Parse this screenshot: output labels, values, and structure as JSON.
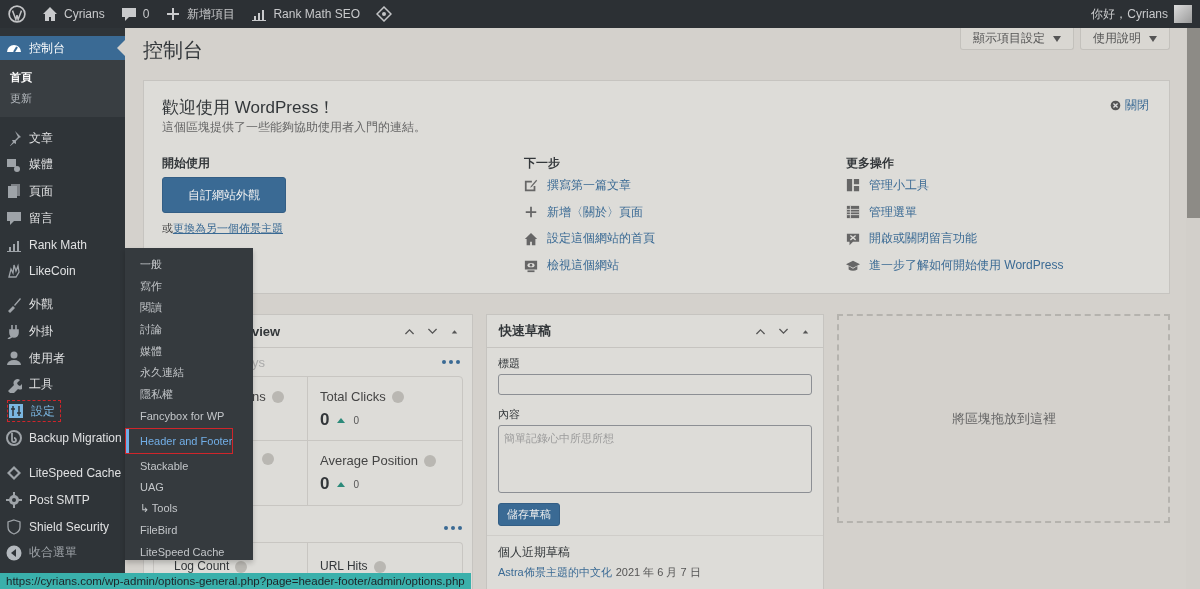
{
  "admin_bar": {
    "site": "Cyrians",
    "comments": "0",
    "new": "新增項目",
    "seo": "Rank Math SEO",
    "greeting": "你好，Cyrians"
  },
  "sidebar": {
    "groups": [
      {
        "items": [
          {
            "label": "控制台",
            "selected": true,
            "hovered": false,
            "outlined": false,
            "children": [
              {
                "label": "首頁",
                "selected": true
              },
              {
                "label": "更新",
                "selected": false
              }
            ]
          }
        ]
      },
      {
        "items": [
          {
            "label": "文章",
            "selected": false,
            "hovered": false,
            "outlined": false
          },
          {
            "label": "媒體",
            "selected": false,
            "hovered": false,
            "outlined": false
          },
          {
            "label": "頁面",
            "selected": false,
            "hovered": false,
            "outlined": false
          },
          {
            "label": "留言",
            "selected": false,
            "hovered": false,
            "outlined": false
          },
          {
            "label": "Rank Math",
            "selected": false,
            "hovered": false,
            "outlined": false
          },
          {
            "label": "LikeCoin",
            "selected": false,
            "hovered": false,
            "outlined": false
          }
        ]
      },
      {
        "items": [
          {
            "label": "外觀",
            "selected": false,
            "hovered": false,
            "outlined": false
          },
          {
            "label": "外掛",
            "selected": false,
            "hovered": false,
            "outlined": false
          },
          {
            "label": "使用者",
            "selected": false,
            "hovered": false,
            "outlined": false
          },
          {
            "label": "工具",
            "selected": false,
            "hovered": false,
            "outlined": false
          },
          {
            "label": "設定",
            "selected": false,
            "hovered": true,
            "outlined": true
          },
          {
            "label": "Backup Migration",
            "selected": false,
            "hovered": false,
            "outlined": false
          }
        ]
      },
      {
        "items": [
          {
            "label": "LiteSpeed Cache",
            "selected": false,
            "hovered": false,
            "outlined": false
          },
          {
            "label": "Post SMTP",
            "selected": false,
            "hovered": false,
            "outlined": false
          },
          {
            "label": "Shield Security",
            "selected": false,
            "hovered": false,
            "outlined": false
          }
        ]
      }
    ],
    "collapse": "收合選單"
  },
  "flyout": {
    "items": [
      {
        "label": "一般",
        "selected": false,
        "outlined": false
      },
      {
        "label": "寫作",
        "selected": false,
        "outlined": false
      },
      {
        "label": "閱讀",
        "selected": false,
        "outlined": false
      },
      {
        "label": "討論",
        "selected": false,
        "outlined": false
      },
      {
        "label": "媒體",
        "selected": false,
        "outlined": false
      },
      {
        "label": "永久連結",
        "selected": false,
        "outlined": false
      },
      {
        "label": "隱私權",
        "selected": false,
        "outlined": false
      },
      {
        "label": "Fancybox for WP",
        "selected": false,
        "outlined": false
      },
      {
        "label": "Header and Footer",
        "selected": true,
        "outlined": true
      },
      {
        "label": "Stackable",
        "selected": false,
        "outlined": false
      },
      {
        "label": "UAG",
        "selected": false,
        "outlined": false
      },
      {
        "label": "↳ Tools",
        "selected": false,
        "outlined": false
      },
      {
        "label": "FileBird",
        "selected": false,
        "outlined": false
      },
      {
        "label": "LiteSpeed Cache",
        "selected": false,
        "outlined": false
      }
    ]
  },
  "screen_options": [
    "顯示項目設定",
    "使用說明"
  ],
  "page_title": "控制台",
  "welcome": {
    "title": "歡迎使用 WordPress！",
    "subtitle": "這個區塊提供了一些能夠協助使用者入門的連結。",
    "dismiss": "關閉",
    "start": {
      "heading": "開始使用",
      "button": "自訂網站外觀",
      "prefix": "或",
      "link": "更換為另一個佈景主題"
    },
    "next": {
      "heading": "下一步",
      "links": [
        "撰寫第一篇文章",
        "新增〈關於〉頁面",
        "設定這個網站的首頁",
        "檢視這個網站"
      ]
    },
    "more": {
      "heading": "更多操作",
      "links": [
        "管理小工具",
        "管理選單",
        "開啟或關閉留言功能",
        "進一步了解如何開始使用 WordPress"
      ]
    }
  },
  "overview": {
    "title": "view",
    "subtitle": "ys",
    "stats": [
      {
        "kind": "label",
        "label": "ns"
      },
      {
        "kind": "full",
        "label": "Total Clicks",
        "value": "0",
        "change": "0"
      },
      {
        "kind": "covered"
      },
      {
        "kind": "full",
        "label": "Average Position",
        "value": "0",
        "change": "0"
      }
    ],
    "lower_stats": [
      {
        "label": "Log Count"
      },
      {
        "label": "URL Hits"
      }
    ]
  },
  "quick_draft": {
    "title": "快速草稿",
    "title_label": "標題",
    "content_label": "內容",
    "placeholder": "簡單記錄心中所思所想",
    "button": "儲存草稿",
    "recent_heading": "個人近期草稿",
    "drafts": [
      {
        "title": "Astra佈景主題的中文化",
        "date": "2021 年 6 月 7 日"
      }
    ]
  },
  "drop_zone": "將區塊拖放到這裡",
  "status_url": "https://cyrians.com/wp-admin/options-general.php?page=header-footer/admin/options.php"
}
